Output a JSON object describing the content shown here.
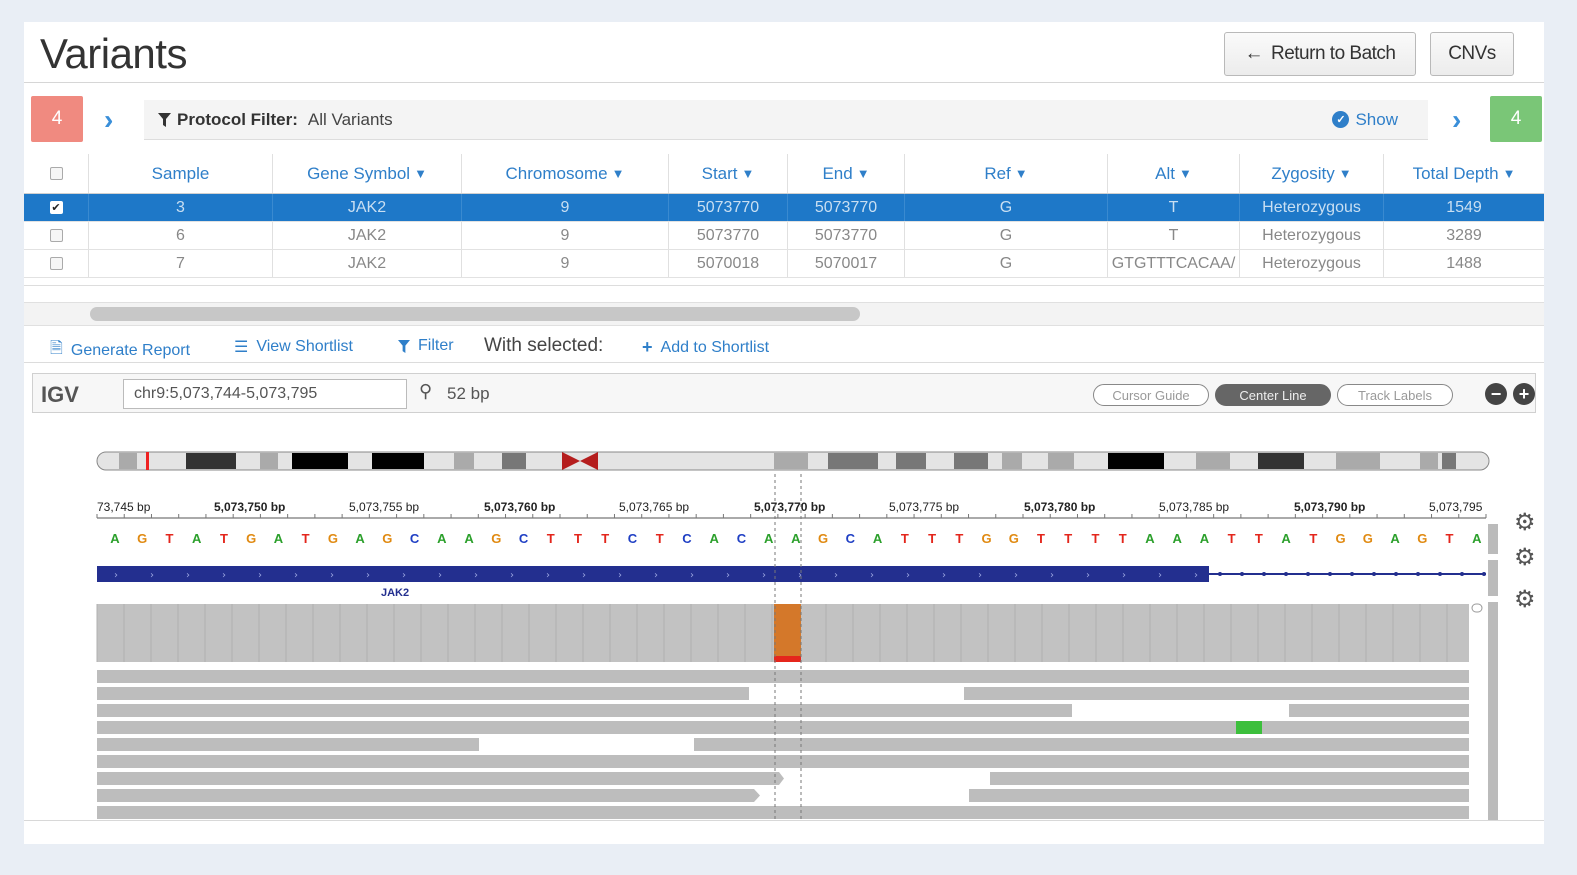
{
  "header": {
    "title": "Variants",
    "return_label": "Return to Batch",
    "return_arrow": "←",
    "cnvs_label": "CNVs"
  },
  "protocol": {
    "left_count": "4",
    "right_count": "4",
    "filter_label": "Protocol Filter:",
    "filter_value": "All Variants",
    "show_label": "Show"
  },
  "table": {
    "columns": [
      "Sample",
      "Gene Symbol",
      "Chromosome",
      "Start",
      "End",
      "Ref",
      "Alt",
      "Zygosity",
      "Total Depth"
    ],
    "rows": [
      {
        "selected": true,
        "cells": [
          "3",
          "JAK2",
          "9",
          "5073770",
          "5073770",
          "G",
          "T",
          "Heterozygous",
          "1549"
        ]
      },
      {
        "selected": false,
        "cells": [
          "6",
          "JAK2",
          "9",
          "5073770",
          "5073770",
          "G",
          "T",
          "Heterozygous",
          "3289"
        ]
      },
      {
        "selected": false,
        "cells": [
          "7",
          "JAK2",
          "9",
          "5070018",
          "5070017",
          "G",
          "GTGTTTCACAA/",
          "Heterozygous",
          "1488"
        ]
      }
    ]
  },
  "actions": {
    "generate_report": "Generate Report",
    "view_shortlist": "View Shortlist",
    "filter": "Filter",
    "with_selected": "With selected:",
    "add_to_shortlist": "Add to Shortlist"
  },
  "igv": {
    "logo": "IGV",
    "locus": "chr9:5,073,744-5,073,795",
    "span": "52 bp",
    "cursor_guide": "Cursor Guide",
    "center_line": "Center Line",
    "track_labels": "Track Labels",
    "ruler_ticks": [
      "73,745 bp",
      "5,073,750 bp",
      "5,073,755 bp",
      "5,073,760 bp",
      "5,073,765 bp",
      "5,073,770 bp",
      "5,073,775 bp",
      "5,073,780 bp",
      "5,073,785 bp",
      "5,073,790 bp",
      "5,073,795"
    ],
    "sequence": "AGTATGATGAGCAAGCTTTCTCACAAGCATTTGGTTTTAAATTATGGAGTA",
    "gene_label": "JAK2",
    "base_colors": {
      "A": "#2ca02c",
      "G": "#e08a12",
      "T": "#e3261c",
      "C": "#1f3fc4"
    }
  }
}
